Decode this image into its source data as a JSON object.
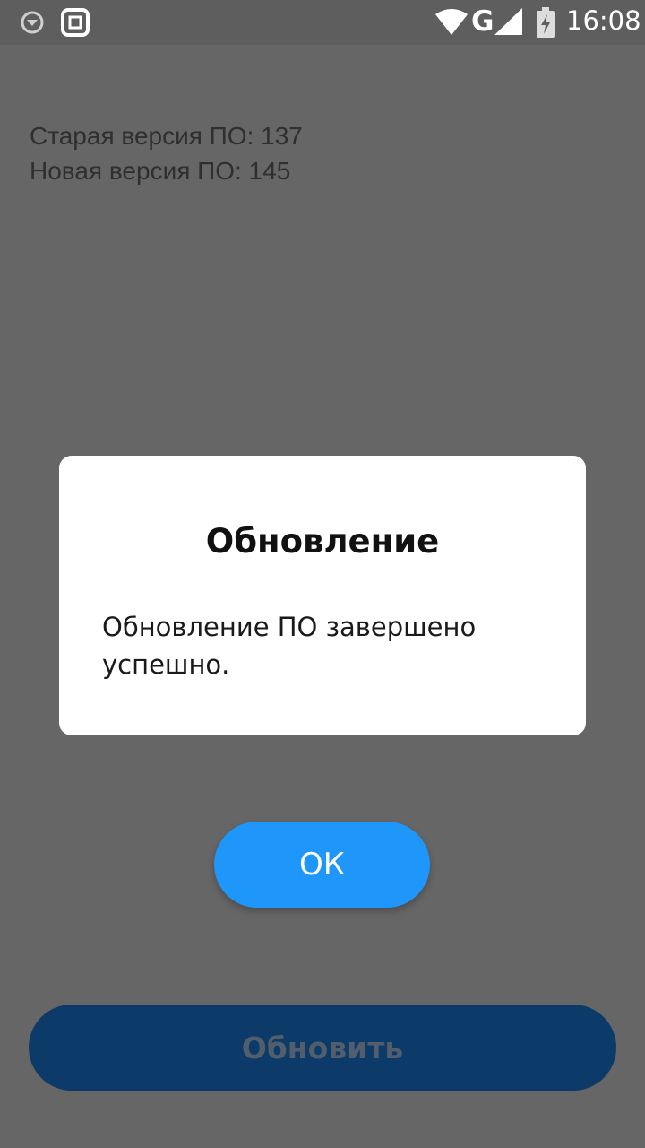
{
  "status_bar": {
    "time": "16:08",
    "network": "G",
    "icons": [
      "download-icon",
      "screenshot-icon",
      "wifi-icon",
      "signal-icon",
      "battery-charging-icon"
    ]
  },
  "screen": {
    "old_version": "Старая версия ПО: 137",
    "new_version": "Новая версия ПО: 145",
    "update_button_label": "Обновить"
  },
  "dialog": {
    "title": "Обновление",
    "message": "Обновление ПО завершено успешно.",
    "ok_label": "ОК"
  },
  "colors": {
    "accent": "#1e96fa",
    "update_button": "#0d3b69",
    "scrim": "#666666"
  }
}
